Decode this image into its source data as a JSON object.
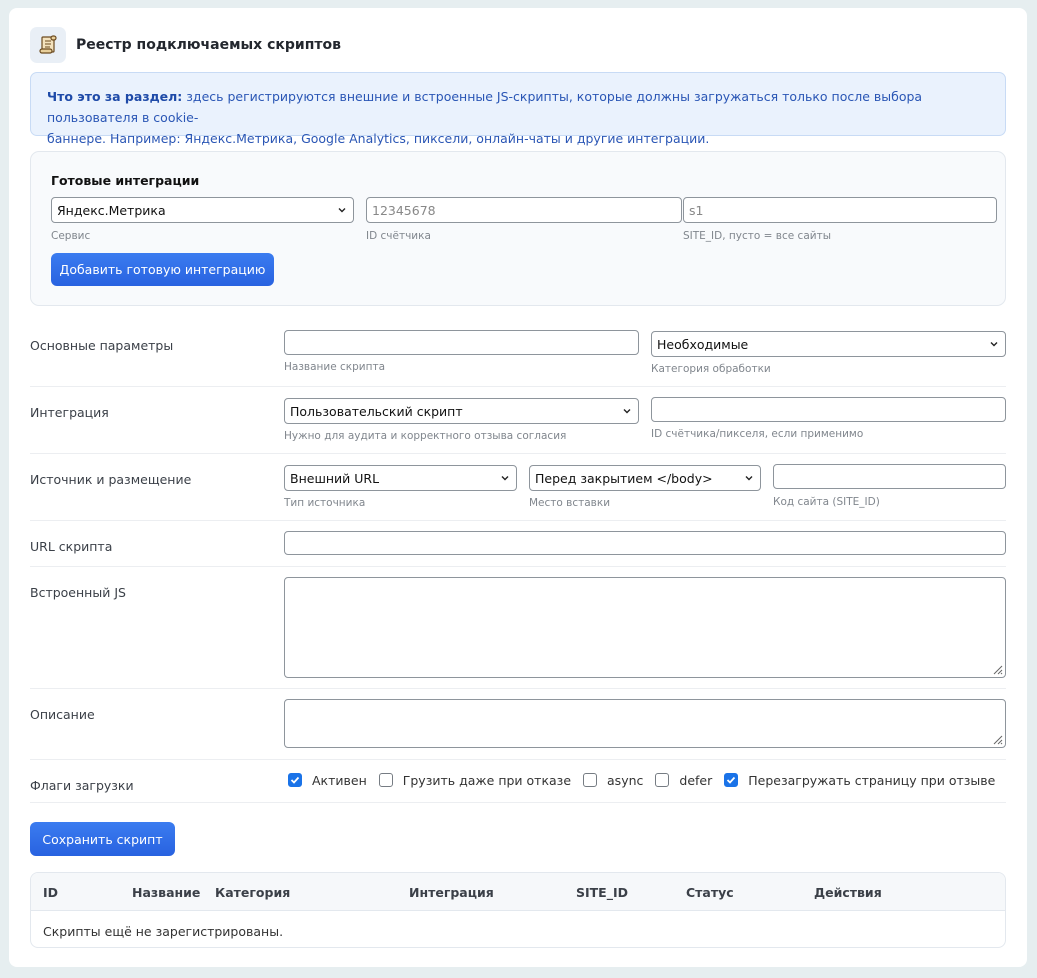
{
  "header": {
    "icon": "scroll-icon",
    "title": "Реестр подключаемых скриптов"
  },
  "info": {
    "lead": "Что это за раздел:",
    "line1": " здесь регистрируются внешние и встроенные JS-скрипты, которые должны загружаться только после выбора пользователя в cookie-",
    "line2": "баннере. Например: Яндекс.Метрика, Google Analytics, пиксели, онлайн-чаты и другие интеграции."
  },
  "ready": {
    "title": "Готовые интеграции",
    "service_value": "Яндекс.Метрика",
    "service_hint": "Сервис",
    "counter_placeholder": "12345678",
    "counter_hint": "ID счётчика",
    "site_value": "s1",
    "site_hint": "SITE_ID, пусто = все сайты",
    "add_button": "Добавить готовую интеграцию"
  },
  "form": {
    "basic": {
      "label": "Основные параметры",
      "name_value": "",
      "name_hint": "Название скрипта",
      "category_value": "Необходимые",
      "category_hint": "Категория обработки"
    },
    "integration": {
      "label": "Интеграция",
      "type_value": "Пользовательский скрипт",
      "type_hint": "Нужно для аудита и корректного отзыва согласия",
      "pixel_value": "",
      "pixel_hint": "ID счётчика/пикселя, если применимо"
    },
    "source": {
      "label": "Источник и размещение",
      "type_value": "Внешний URL",
      "type_hint": "Тип источника",
      "place_value": "Перед закрытием </body>",
      "place_hint": "Место вставки",
      "site_value": "",
      "site_hint": "Код сайта (SITE_ID)"
    },
    "url": {
      "label": "URL скрипта",
      "value": ""
    },
    "inline": {
      "label": "Встроенный JS",
      "value": ""
    },
    "description": {
      "label": "Описание",
      "value": ""
    },
    "flags": {
      "label": "Флаги загрузки",
      "items": [
        {
          "label": "Активен",
          "checked": true
        },
        {
          "label": "Грузить даже при отказе",
          "checked": false
        },
        {
          "label": "async",
          "checked": false
        },
        {
          "label": "defer",
          "checked": false
        },
        {
          "label": "Перезагружать страницу при отзыве",
          "checked": true
        }
      ]
    },
    "save_button": "Сохранить скрипт"
  },
  "table": {
    "columns": [
      "ID",
      "Название",
      "Категория",
      "Интеграция",
      "SITE_ID",
      "Статус",
      "Действия"
    ],
    "empty_text": "Скрипты ещё не зарегистрированы."
  },
  "colors": {
    "accent": "#2862e0",
    "info_bg": "#eaf2fd",
    "info_text": "#2a56b5",
    "checkbox_on": "#1a73e8"
  }
}
